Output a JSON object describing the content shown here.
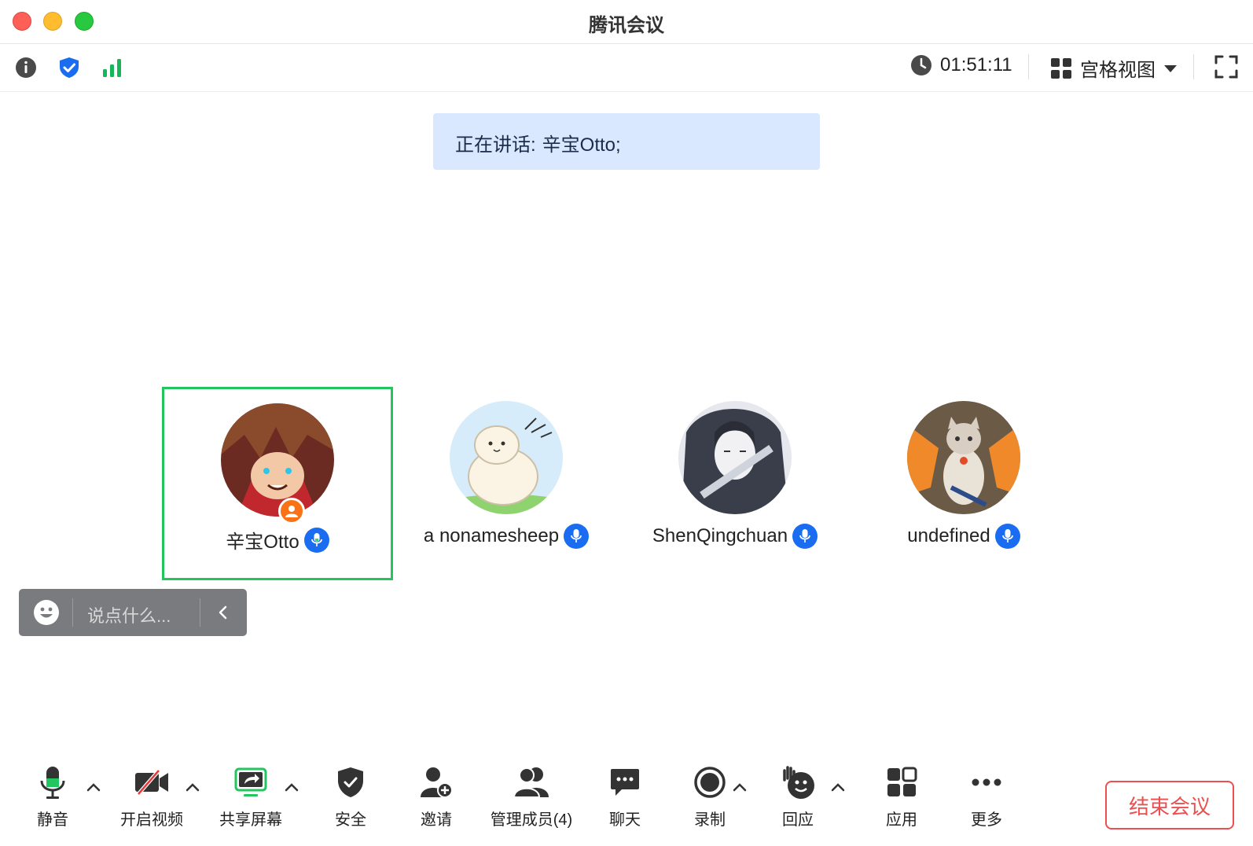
{
  "window": {
    "title": "腾讯会议"
  },
  "infobar": {
    "timer": "01:51:11",
    "view_label": "宫格视图",
    "icons": [
      "info-icon",
      "shield-check-icon",
      "signal-bars-icon"
    ],
    "signal_color": "#16b75a",
    "shield_color": "#1a6cf0"
  },
  "speaking": {
    "label": "正在讲话:",
    "names": "辛宝Otto;"
  },
  "participants": [
    {
      "name": "辛宝Otto",
      "active": true,
      "host": true,
      "mic": "on"
    },
    {
      "name": "a nonamesheep",
      "active": false,
      "host": false,
      "mic": "on"
    },
    {
      "name": "ShenQingchuan",
      "active": false,
      "host": false,
      "mic": "on"
    },
    {
      "name": "undefined",
      "active": false,
      "host": false,
      "mic": "on"
    }
  ],
  "chatbar": {
    "placeholder": "说点什么..."
  },
  "toolbar": {
    "items": [
      {
        "label": "静音",
        "icon": "microphone-icon"
      },
      {
        "label": "开启视频",
        "icon": "video-off-icon"
      },
      {
        "label": "共享屏幕",
        "icon": "share-screen-icon"
      },
      {
        "label": "安全",
        "icon": "shield-icon"
      },
      {
        "label": "邀请",
        "icon": "invite-user-icon"
      },
      {
        "label": "管理成员(4)",
        "icon": "members-icon"
      },
      {
        "label": "聊天",
        "icon": "chat-bubble-icon"
      },
      {
        "label": "录制",
        "icon": "record-icon"
      },
      {
        "label": "回应",
        "icon": "reaction-hand-icon"
      },
      {
        "label": "应用",
        "icon": "apps-grid-icon"
      },
      {
        "label": "更多",
        "icon": "more-dots-icon"
      }
    ],
    "end_label": "结束会议",
    "end_color": "#ee4e4e",
    "active_green": "#22c55e"
  }
}
